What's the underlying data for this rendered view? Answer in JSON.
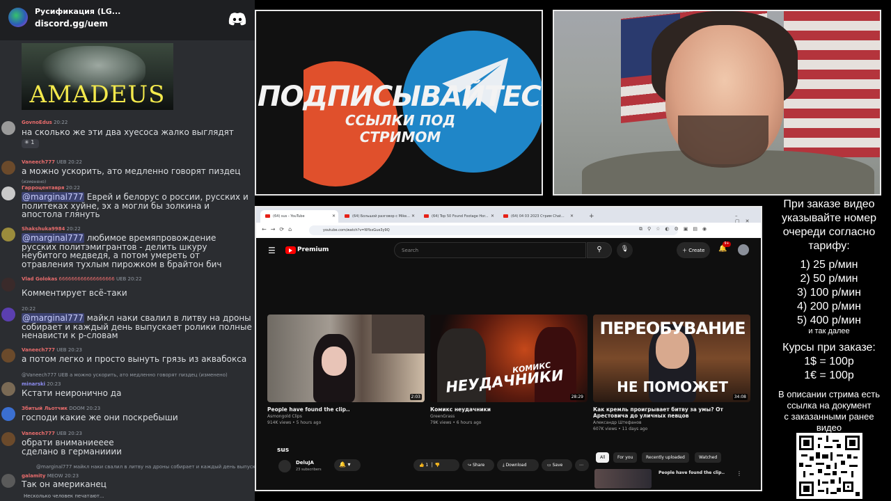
{
  "chat": {
    "server_name": "Русификация (LG...",
    "server_link": "discord.gg/uem",
    "embed_title": "AMADEUS",
    "typing": "Несколько человек печатают...",
    "reaction": "1",
    "messages": [
      {
        "user": "GovnoEdus",
        "time": "20:22",
        "text": "на сколько же эти два хуесоса жалко выглядят"
      },
      {
        "user": "Vaneech777",
        "tag": "UEB",
        "time": "20:22",
        "text": "а можно ускорить, ато медленно говорят пиздец",
        "edited": "(изменено)"
      },
      {
        "user": "Гарроцентавря",
        "time": "20:22",
        "mention": "@marginal777",
        "text": " Еврей и белорус о россии, русских и политеках хуйне, эх а могли бы золкина и апостола глянуть"
      },
      {
        "user": "Shakshuka9984",
        "time": "20:22",
        "mention": "@marginal777",
        "text": " любимое времяпровождение русских политэмигрантов - делить шкуру неубитого медведя, а потом умереть от отравления тухлым пирожком в брайтон бич"
      },
      {
        "user": "Vlad Golokas",
        "extra": "666666666666666666",
        "tag": "UEB",
        "time": "20:22",
        "text": "Комментирует всё-таки"
      },
      {
        "user": "",
        "time": "20:22",
        "mention": "@marginal777",
        "text": " майкл наки свалил в литву на дроны собирает и каждый день выпускает ролики полные ненависти к р-словам"
      },
      {
        "user": "Vaneech777",
        "tag": "UEB",
        "time": "20:23",
        "text": "а потом легко и просто вынуть грязь из аквабокса"
      },
      {
        "reply": "@Vaneech777 UEB а можно ускорить, ато медленно говорят пиздец (изменено)",
        "user": "minarski",
        "time": "20:23",
        "text": "Кстати неиронично да"
      },
      {
        "user": "Збитый Льотчик",
        "tag": "DOOM",
        "time": "20:23",
        "text": "господи какие же они поскребыши"
      },
      {
        "user": "Vaneech777",
        "tag": "UEB",
        "time": "20:23",
        "text": "обрати вниманиееее\nсделано в германииии"
      },
      {
        "reply": "@marginal777 майкл наки свалил в литву на дроны собирает и каждый день выпускает роли",
        "user": "galamity",
        "tag": "MEOW",
        "time": "20:23",
        "text": "Так он американец"
      }
    ]
  },
  "banner": {
    "line1": "ПОДПИСЫВАЙТЕСЬ",
    "line2": "ССЫЛКИ ПОД СТРИМОМ"
  },
  "browser": {
    "tabs": [
      {
        "label": "(64) sus - YouTube"
      },
      {
        "label": "(64) Большой разговор с Mike..."
      },
      {
        "label": "(64) Top 50 Found Footage Hor..."
      },
      {
        "label": "(64) 04 03 2023 Стрим Chat..."
      }
    ],
    "url": "youtube.com/watch?v=NYbxGue3y9Q",
    "new_tab": "+",
    "youtube": {
      "brand": "Premium",
      "search_placeholder": "Search",
      "create": "Create",
      "badge": "9+",
      "videos": [
        {
          "title": "People have found the clip..",
          "channel": "Asmongold Clips",
          "stats": "914K views • 5 hours ago",
          "duration": "2:03"
        },
        {
          "title": "Комикс неудачники",
          "channel": "GreenGrass",
          "stats": "79K views • 6 hours ago",
          "duration": "28:29",
          "thumb_text_1": "КОМИКС",
          "thumb_text_2": "НЕУДАЧНИКИ"
        },
        {
          "title": "Как кремль проигрывает битву за умы? От Арестовича до уличных певцов",
          "channel": "Александр Штефанов",
          "stats": "607K views • 11 days ago",
          "duration": "34:08",
          "thumb_text_1": "ПЕРЕОБУВАНИЕ",
          "thumb_text_2": "НЕ ПОМОЖЕТ"
        }
      ],
      "current_title": "sus",
      "channel_name": "DeluJA",
      "subscribers": "23 subscribers",
      "like_count": "1",
      "share": "Share",
      "download": "Download",
      "save": "Save",
      "chips": [
        "All",
        "For you",
        "Recently uploaded",
        "Watched"
      ],
      "up_next_title": "People have found the clip.."
    }
  },
  "price": {
    "header": [
      "При заказе видео",
      "указывайте номер",
      "очереди согласно",
      "тарифу:"
    ],
    "tiers": [
      "1) 25 р/мин",
      "2) 50 р/мин",
      "3) 100 р/мин",
      "4) 200 р/мин",
      "5) 400 р/мин"
    ],
    "etc": "и так далее",
    "rates_header": "Курсы при заказе:",
    "rates": [
      "1$ = 100р",
      "1€ = 100р"
    ],
    "desc": [
      "В описании стрима есть",
      "ссылка на документ",
      "с заказанными ранее",
      "видео"
    ]
  },
  "colors": {
    "chat_bg": "#2b2d31",
    "mention_bg": "#3c4270",
    "youtube_red": "#ff0000",
    "patreon": "#e0502c",
    "telegram": "#1f86c8"
  }
}
